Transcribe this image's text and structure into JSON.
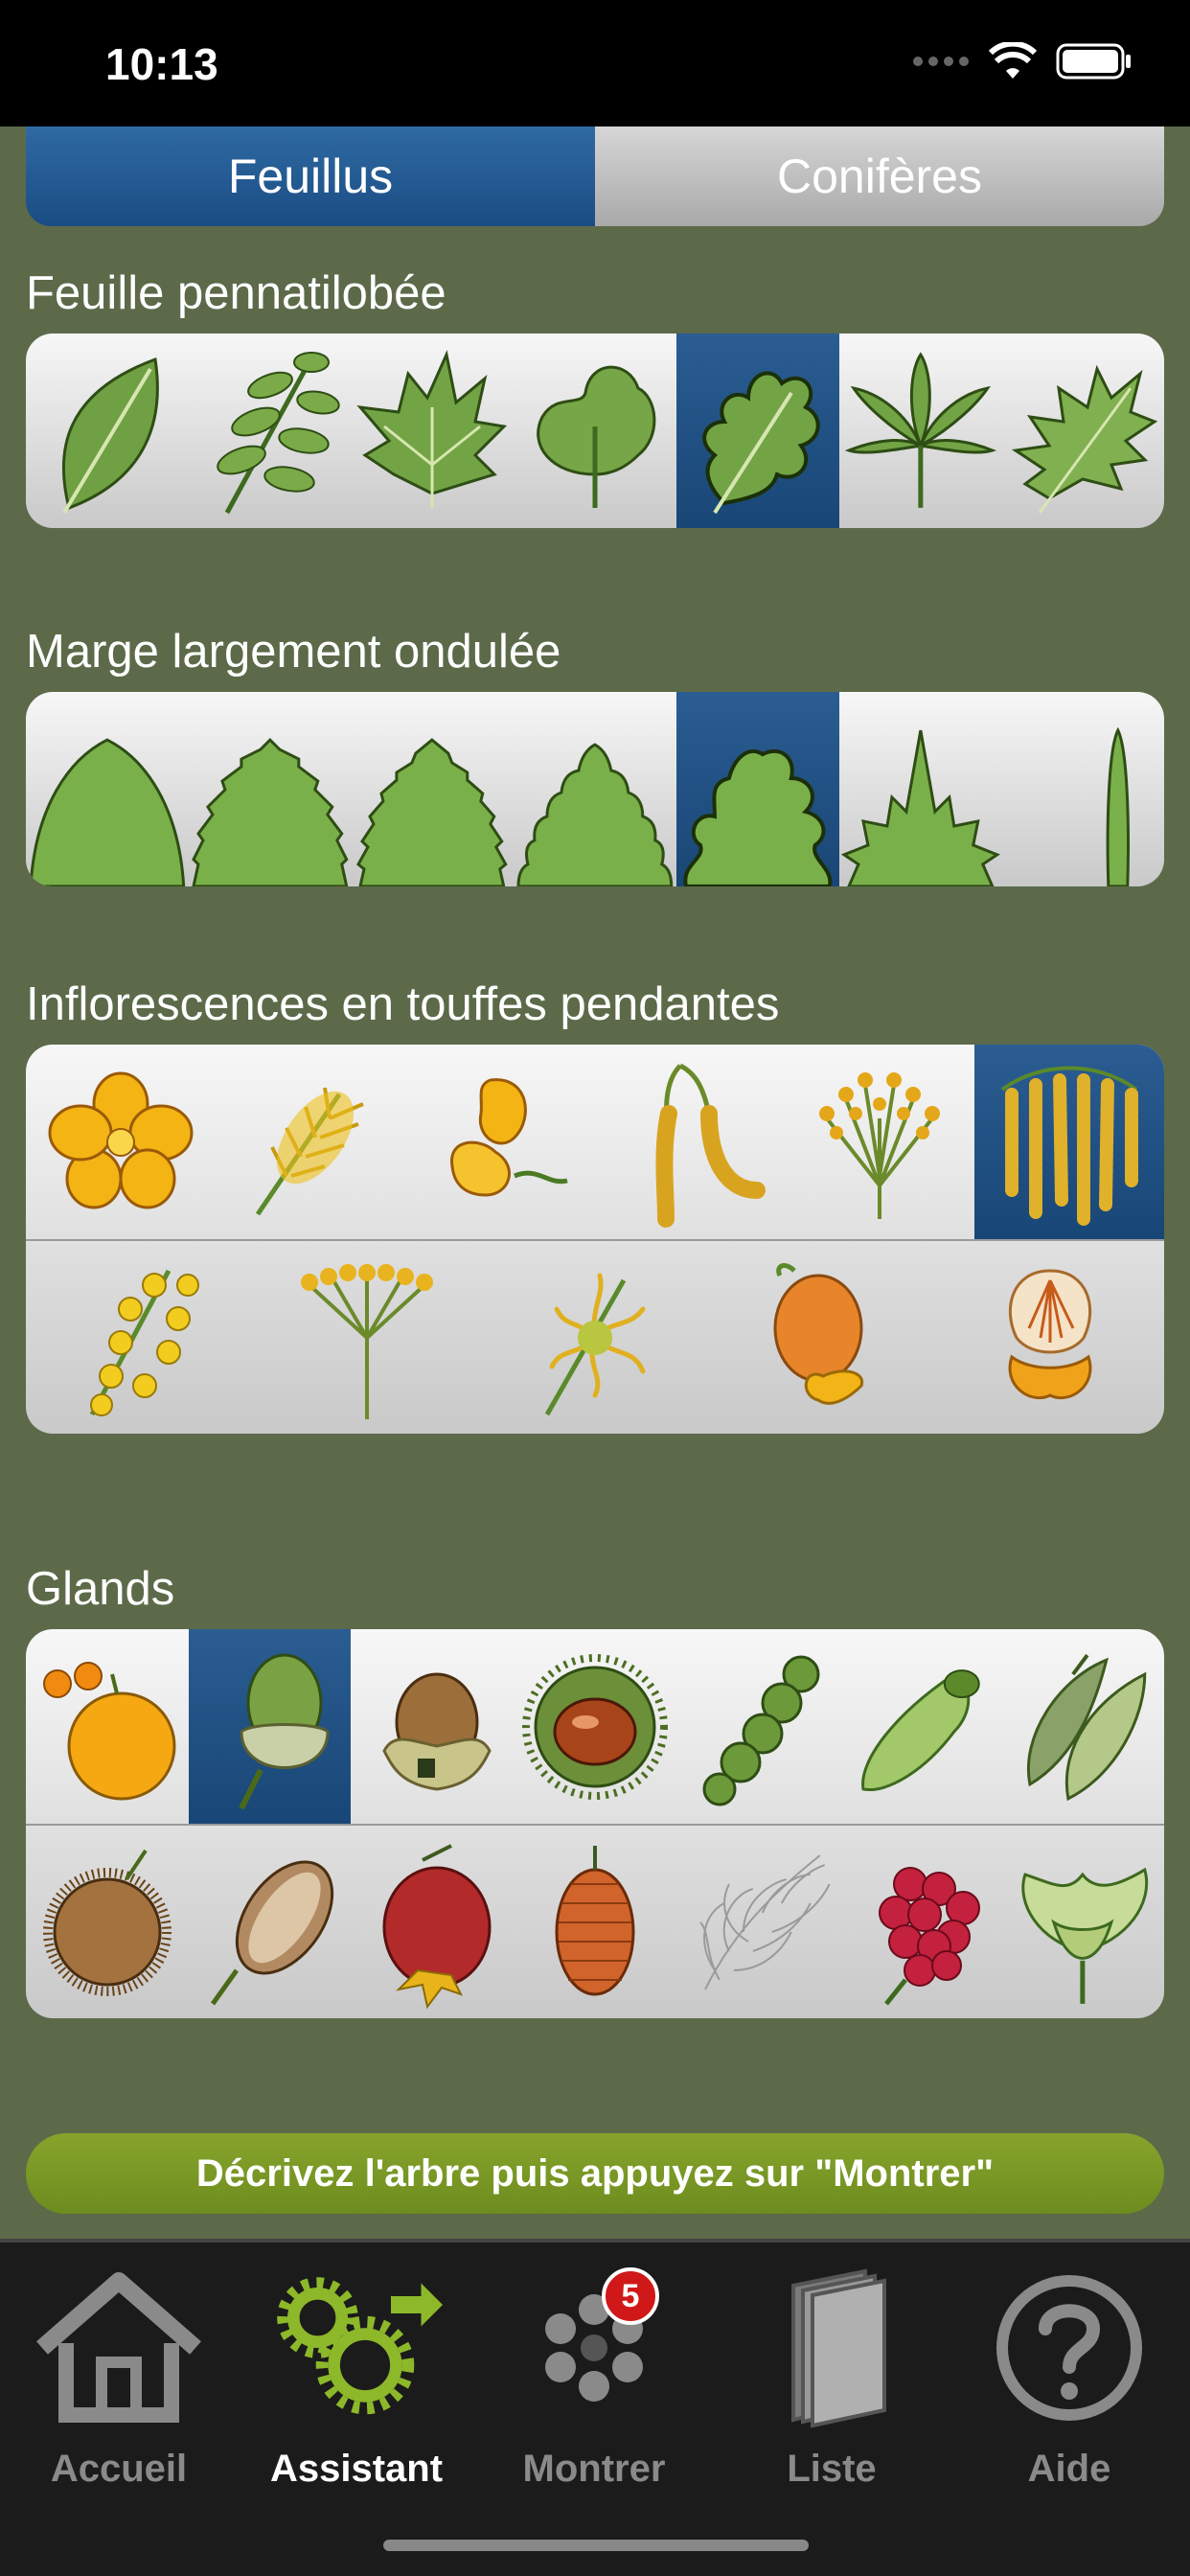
{
  "status": {
    "time": "10:13"
  },
  "segments": {
    "left": "Feuillus",
    "right": "Conifères"
  },
  "sections": {
    "leaf_shape": "Feuille pennatilobée",
    "margin": "Marge largement ondulée",
    "inflorescence": "Inflorescences en touffes pendantes",
    "fruit": "Glands"
  },
  "hint": "Décrivez l'arbre puis appuyez sur \"Montrer\"",
  "tabs": {
    "home": "Accueil",
    "assistant": "Assistant",
    "show": "Montrer",
    "show_badge": "5",
    "list": "Liste",
    "help": "Aide"
  },
  "colors": {
    "background": "#5c6a4a",
    "selected": "#1f5288",
    "hint_bar": "#7a9824",
    "badge": "#d01818"
  },
  "icons": {
    "leaf_shapes": [
      "simple-leaf-icon",
      "pinnate-leaf-icon",
      "palmate-lobed-leaf-icon",
      "trilobed-leaf-icon",
      "pinnatilobed-leaf-icon",
      "palmate-compound-leaf-icon",
      "pinnatifid-deep-leaf-icon"
    ],
    "margins": [
      "entire-margin-icon",
      "serrate-margin-icon",
      "double-serrate-margin-icon",
      "crenate-margin-icon",
      "sinuate-margin-icon",
      "spiny-margin-icon",
      "linear-margin-icon"
    ],
    "inflorescence_row1": [
      "open-flower-icon",
      "spike-flower-icon",
      "pea-flower-icon",
      "hanging-catkin-icon",
      "brush-flower-icon",
      "pendant-tufts-icon"
    ],
    "inflorescence_row2": [
      "panicle-flower-icon",
      "umbel-flower-icon",
      "spidery-flower-icon",
      "orange-bell-flower-icon",
      "orchid-flower-icon"
    ],
    "fruit_row1": [
      "orange-fruit-icon",
      "acorn-icon",
      "hazelnut-icon",
      "chestnut-icon",
      "pod-icon",
      "samara-icon",
      "legume-pod-icon"
    ],
    "fruit_row2": [
      "spiky-ball-icon",
      "nut-icon",
      "rosehip-icon",
      "cone-icon",
      "feathery-seed-icon",
      "raspberry-icon",
      "husk-fruit-icon"
    ]
  }
}
